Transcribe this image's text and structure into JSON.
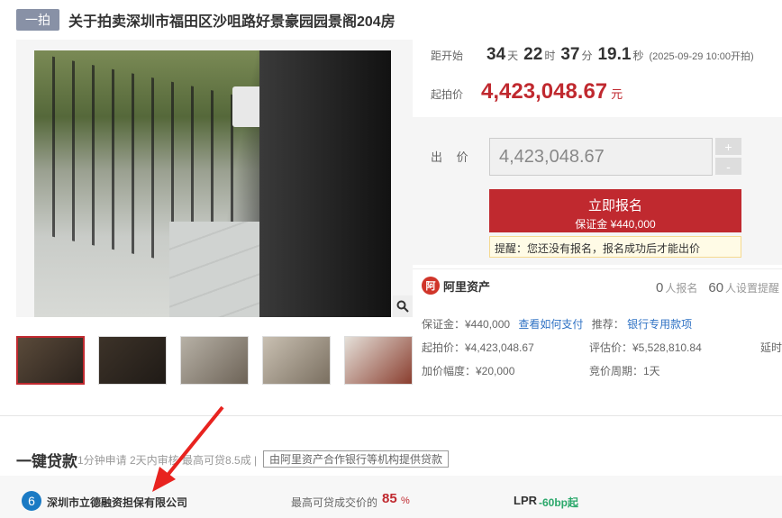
{
  "header": {
    "tag": "一拍",
    "title": "关于拍卖深圳市福田区沙咀路好景豪园园景阁204房"
  },
  "countdown": {
    "label": "距开始",
    "days": "34",
    "days_unit": "天",
    "hours": "22",
    "hours_unit": "时",
    "minutes": "37",
    "minutes_unit": "分",
    "seconds": "19.1",
    "seconds_unit": "秒",
    "start_note": "(2025-09-29 10:00开拍)"
  },
  "start_price": {
    "label": "起拍价",
    "value": "4,423,048.67",
    "unit": "元"
  },
  "bid": {
    "label": "出 价",
    "value": "4,423,048.67",
    "plus": "+",
    "minus": "-",
    "signup_label": "立即报名",
    "deposit_line": "保证金 ¥440,000",
    "hint": "提醒：您还没有报名，报名成功后才能出价"
  },
  "platform": {
    "logo_glyph": "阿",
    "name": "阿里资产",
    "signup_count": "0",
    "signup_label": "人报名",
    "reminder_count": "60",
    "reminder_label": "人设置提醒"
  },
  "details": {
    "deposit": "保证金：¥440,000",
    "how_to_pay": "查看如何支付",
    "recommend": "推荐：",
    "bank_loan": "银行专用款项",
    "start_price": "起拍价：¥4,423,048.67",
    "appraisal": "评估价：¥5,528,810.84",
    "delay": "延时",
    "increment": "加价幅度：¥20,000",
    "cycle": "竞价周期：1天"
  },
  "loan": {
    "title": "一键贷款",
    "subtitle": "1分钟申请 2天内审核 最高可贷8.5成 |",
    "tag": "由阿里资产合作银行等机构提供贷款",
    "bank_logo_glyph": "6",
    "bank_name": "深圳市立德融资担保有限公司",
    "ratio_label": "最高可贷成交价的",
    "ratio": "85",
    "ratio_unit": "%",
    "lpr_label": "LPR",
    "lpr_value": "-60bp起"
  },
  "icons": {
    "zoom": "magnifier-icon",
    "arrow": "red-arrow-annotation"
  },
  "colors": {
    "accent": "#c0292f",
    "link": "#2f72c4",
    "green": "#2ba86b"
  }
}
